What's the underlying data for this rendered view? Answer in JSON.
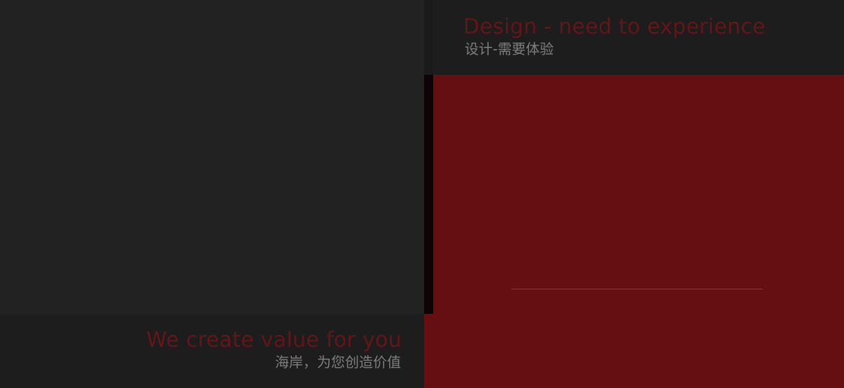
{
  "header": {
    "title_en": "Design - need to experience",
    "title_cn": "设计-需要体验"
  },
  "footer": {
    "title_en": "We create value for you",
    "title_cn": "海岸，为您创造价值"
  },
  "colors": {
    "accent_red": "#650f12",
    "title_red": "#641518",
    "subtitle_gray": "#7e7e7e",
    "dark_bg": "#1d1d1d"
  }
}
